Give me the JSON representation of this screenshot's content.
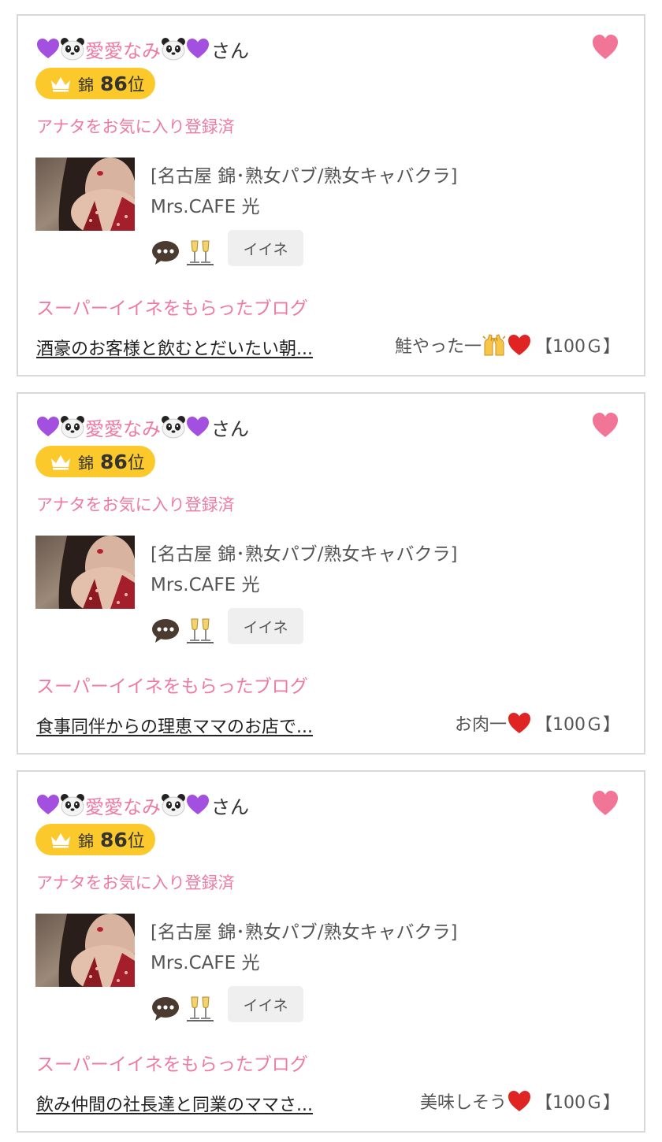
{
  "colors": {
    "accent_pink": "#ee7aa4",
    "heart_pink": "#f27496",
    "badge_yellow": "#fcc92c",
    "card_border": "#d8d8d8"
  },
  "cards": [
    {
      "name_prefix_icons": [
        "purple-heart-icon",
        "panda-icon"
      ],
      "name": "愛愛なみ",
      "name_suffix_icons": [
        "panda-icon",
        "purple-heart-icon"
      ],
      "honorific": "さん",
      "rank_area": "錦",
      "rank_number": "86",
      "rank_unit": "位",
      "favorite_status": "アナタをお気に入り登録済",
      "shop_area": "[名古屋 錦･熟女パブ/熟女キャバクラ]",
      "shop_name": "Mrs.CAFE 光",
      "iine_label": "イイネ",
      "section_title": "スーパーイイネをもらったブログ",
      "blog_title": "酒豪のお客様と飲むとだいたい朝...",
      "comment_text": "鮭やった一",
      "comment_icons": [
        "raised-hands-icon",
        "red-heart-icon"
      ],
      "price": "【100Ｇ】"
    },
    {
      "name_prefix_icons": [
        "purple-heart-icon",
        "panda-icon"
      ],
      "name": "愛愛なみ",
      "name_suffix_icons": [
        "panda-icon",
        "purple-heart-icon"
      ],
      "honorific": "さん",
      "rank_area": "錦",
      "rank_number": "86",
      "rank_unit": "位",
      "favorite_status": "アナタをお気に入り登録済",
      "shop_area": "[名古屋 錦･熟女パブ/熟女キャバクラ]",
      "shop_name": "Mrs.CAFE 光",
      "iine_label": "イイネ",
      "section_title": "スーパーイイネをもらったブログ",
      "blog_title": "食事同伴からの理恵ママのお店で...",
      "comment_text": "お肉一",
      "comment_icons": [
        "red-heart-icon"
      ],
      "price": "【100Ｇ】"
    },
    {
      "name_prefix_icons": [
        "purple-heart-icon",
        "panda-icon"
      ],
      "name": "愛愛なみ",
      "name_suffix_icons": [
        "panda-icon",
        "purple-heart-icon"
      ],
      "honorific": "さん",
      "rank_area": "錦",
      "rank_number": "86",
      "rank_unit": "位",
      "favorite_status": "アナタをお気に入り登録済",
      "shop_area": "[名古屋 錦･熟女パブ/熟女キャバクラ]",
      "shop_name": "Mrs.CAFE 光",
      "iine_label": "イイネ",
      "section_title": "スーパーイイネをもらったブログ",
      "blog_title": "飲み仲間の社長達と同業のママさ...",
      "comment_text": "美味しそう",
      "comment_icons": [
        "red-heart-icon"
      ],
      "price": "【100Ｇ】"
    }
  ]
}
